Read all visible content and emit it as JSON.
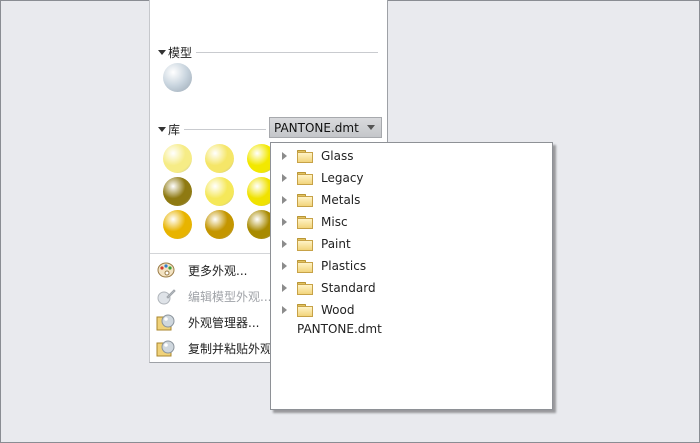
{
  "panel": {
    "model_section": {
      "label": "模型"
    },
    "library_section": {
      "label": "库",
      "selected_library": "PANTONE.dmt"
    },
    "model_sphere": {
      "color": "#c8d4de"
    },
    "library_spheres": [
      {
        "color": "#f6ec86"
      },
      {
        "color": "#f5e668"
      },
      {
        "color": "#f2e800"
      },
      {
        "color": "#8f7a12"
      },
      {
        "color": "#f5e85a"
      },
      {
        "color": "#f0e200"
      },
      {
        "color": "#e8b400"
      },
      {
        "color": "#c49600"
      },
      {
        "color": "#a88a00"
      }
    ],
    "commands": [
      {
        "label": "更多外观...",
        "icon": "palette-icon",
        "enabled": true
      },
      {
        "label": "编辑模型外观...",
        "icon": "edit-appearance-icon",
        "enabled": false
      },
      {
        "label": "外观管理器...",
        "icon": "appearance-manager-icon",
        "enabled": true
      },
      {
        "label": "复制并粘贴外观",
        "icon": "copy-paste-appearance-icon",
        "enabled": true
      }
    ]
  },
  "library_dropdown": {
    "folders": [
      {
        "label": "Glass"
      },
      {
        "label": "Legacy"
      },
      {
        "label": "Metals"
      },
      {
        "label": "Misc"
      },
      {
        "label": "Paint"
      },
      {
        "label": "Plastics"
      },
      {
        "label": "Standard"
      },
      {
        "label": "Wood"
      }
    ],
    "file": "PANTONE.dmt"
  }
}
